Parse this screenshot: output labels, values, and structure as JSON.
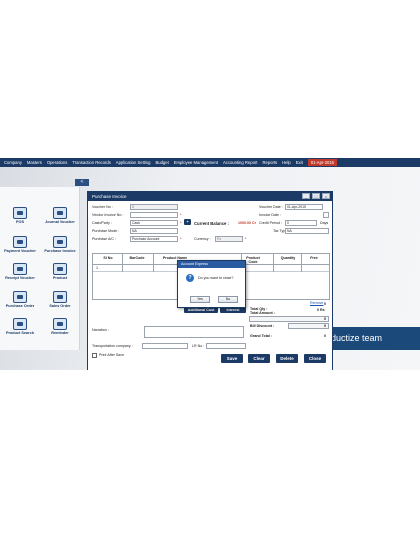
{
  "menubar": {
    "items": [
      "Company",
      "Masters",
      "Operations",
      "Transaction Records",
      "Application Setting",
      "Budget",
      "Employee Management",
      "Accounting Report",
      "Reports",
      "Help",
      "Exit"
    ],
    "date": "01-Apr-2015"
  },
  "sidebar": {
    "toggle": "<",
    "tiles": [
      {
        "label": "POS",
        "icon": "pos-icon"
      },
      {
        "label": "Journal Voucher",
        "icon": "journal-voucher-icon"
      },
      {
        "label": "Payment Voucher",
        "icon": "payment-voucher-icon"
      },
      {
        "label": "Purchase Invoice",
        "icon": "purchase-invoice-icon"
      },
      {
        "label": "Receipt Voucher",
        "icon": "receipt-voucher-icon"
      },
      {
        "label": "Product",
        "icon": "product-icon"
      },
      {
        "label": "Purchase Order",
        "icon": "purchase-order-icon"
      },
      {
        "label": "Sales Order",
        "icon": "sales-order-icon"
      },
      {
        "label": "Product Search",
        "icon": "product-search-icon"
      },
      {
        "label": "Reminder",
        "icon": "reminder-icon"
      }
    ]
  },
  "banner": {
    "text": "roductize team"
  },
  "window": {
    "title": "Purchase Invoice",
    "controls": {
      "minimize": "_",
      "maximize": "□",
      "close": "×"
    },
    "form": {
      "voucher_no_label": "Voucher No :",
      "voucher_no_value": "8",
      "vendor_invoice_no_label": "Vendor Invoice No :",
      "cash_party_label": "Cash/Party :",
      "cash_party_value": "Cash",
      "purchase_mode_label": "Purchase Mode :",
      "purchase_mode_value": "NA",
      "purchase_ac_label": "Purchase A/C :",
      "purchase_ac_value": "Purchase Account",
      "current_balance_label": "Current Balance :",
      "current_balance_value": "1000.00 Cr",
      "currency_label": "Currency :",
      "currency_value": "Rs",
      "voucher_date_label": "Voucher Date :",
      "voucher_date_value": "01-Apr-2015",
      "invoice_date_label": "Invoice Date :",
      "credit_period_label": "Credit Period :",
      "credit_period_value": "0",
      "credit_period_unit": "Days",
      "tax_type_label": "Tax Type :",
      "tax_type_value": "NA",
      "star": "*"
    },
    "grid": {
      "columns": [
        "Sl No",
        "BarCode",
        "Product Name",
        "Product Code",
        "Quantity",
        "Free"
      ],
      "rows": [
        [
          "1",
          "",
          "",
          "",
          "",
          ""
        ]
      ]
    },
    "remove_link": "Remove",
    "additional_cost_button": "Additional Cost",
    "interest_button": "Interest",
    "totals": {
      "total_qty_label": "Total Qty :",
      "total_qty_value": "0",
      "total_amount_label": "Total Amount :",
      "total_amount_value": "0 Rs",
      "additional_cost_label": "Additional Cost :",
      "additional_cost_value": "0",
      "bill_discount_label": "Bill Discount :",
      "bill_discount_value": "0",
      "grand_total_label": "Grand Total :",
      "grand_total_value": "0"
    },
    "narration_label": "Narration :",
    "transportation_label": "Transportation company :",
    "lr_no_label": "LR No :",
    "print_after_save_label": "Print After Save",
    "buttons": {
      "save": "Save",
      "clear": "Clear",
      "delete": "Delete",
      "close": "Close"
    }
  },
  "dialog": {
    "title": "Account Express",
    "message": "Do you want to close?",
    "yes": "Yes",
    "no": "No"
  }
}
